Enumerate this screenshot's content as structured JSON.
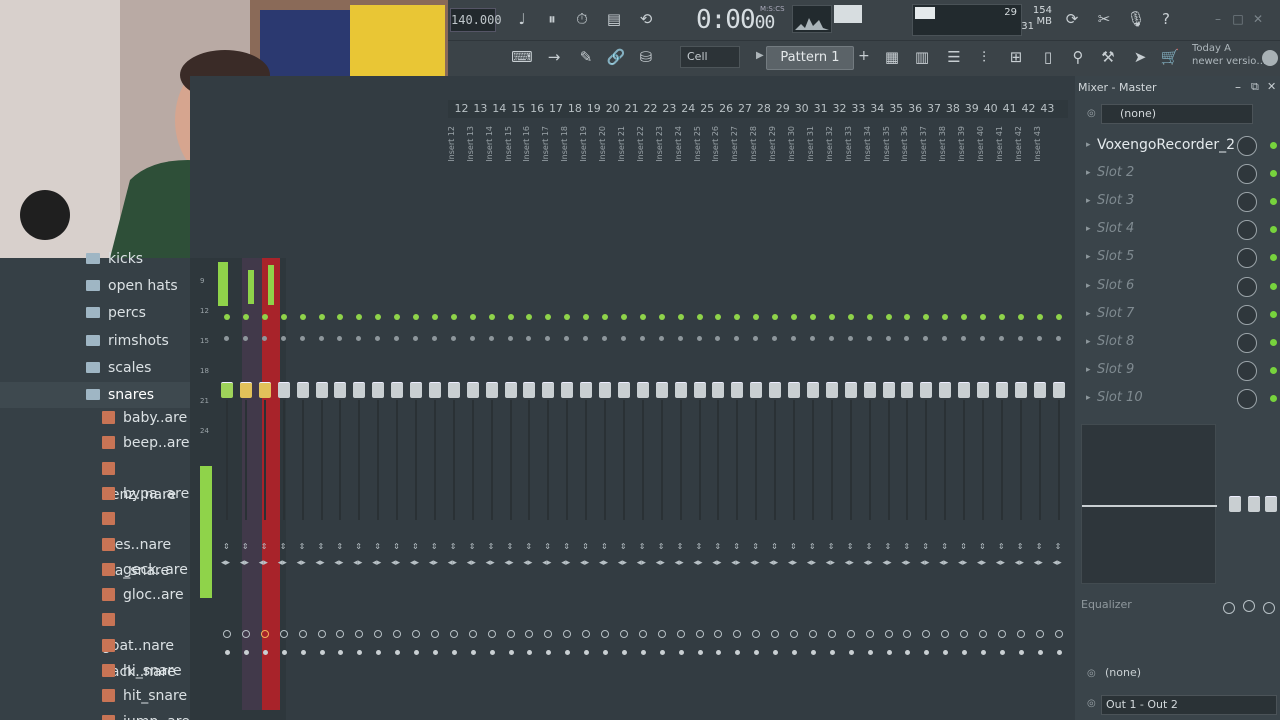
{
  "toolbar": {
    "tempo": "140.000",
    "time": "0:00",
    "time_frac": "00",
    "time_mode": "M:S:CS",
    "cpu_count": "29",
    "memory": "154 MB",
    "polyphony": "31",
    "snap": "Cell",
    "pattern": "Pattern 1",
    "news_line1": "Today  A",
    "news_line2": "newer versio…"
  },
  "browser": {
    "folders": [
      "kicks",
      "open hats",
      "percs",
      "rimshots",
      "scales",
      "snares"
    ],
    "files": [
      "baby..are",
      "beep..are",
      "benz..nare",
      "bypa..are",
      "dies..nare",
      "fila_snare",
      "geck..are",
      "gloc..are",
      "goat..nare",
      "hack..nare",
      "hi_snare",
      "hit_snare",
      "jump..are"
    ]
  },
  "mixer": {
    "track_numbers": [
      "12",
      "13",
      "14",
      "15",
      "16",
      "17",
      "18",
      "19",
      "20",
      "21",
      "22",
      "23",
      "24",
      "25",
      "26",
      "27",
      "28",
      "29",
      "30",
      "31",
      "32",
      "33",
      "34",
      "35",
      "36",
      "37",
      "38",
      "39",
      "40",
      "41",
      "42",
      "43"
    ],
    "track_labels": [
      "Insert 12",
      "Insert 13",
      "Insert 14",
      "Insert 15",
      "Insert 16",
      "Insert 17",
      "Insert 18",
      "Insert 19",
      "Insert 20",
      "Insert 21",
      "Insert 22",
      "Insert 23",
      "Insert 24",
      "Insert 25",
      "Insert 26",
      "Insert 27",
      "Insert 28",
      "Insert 29",
      "Insert 30",
      "Insert 31",
      "Insert 32",
      "Insert 33",
      "Insert 34",
      "Insert 35",
      "Insert 36",
      "Insert 37",
      "Insert 38",
      "Insert 39",
      "Insert 40",
      "Insert 41",
      "Insert 42",
      "Insert 43"
    ],
    "meter_scale": [
      "9",
      "12",
      "15",
      "18",
      "21",
      "24"
    ]
  },
  "master": {
    "title": "Mixer - Master",
    "input": "(none)",
    "slots": [
      "VoxengoRecorder_2",
      "Slot 2",
      "Slot 3",
      "Slot 4",
      "Slot 5",
      "Slot 6",
      "Slot 7",
      "Slot 8",
      "Slot 9",
      "Slot 10"
    ],
    "eq_label": "Equalizer",
    "output_none": "(none)",
    "output": "Out 1 - Out 2"
  },
  "colors": {
    "accent_green": "#8fd34a",
    "record_red": "#b32026",
    "panel": "#333c42"
  }
}
